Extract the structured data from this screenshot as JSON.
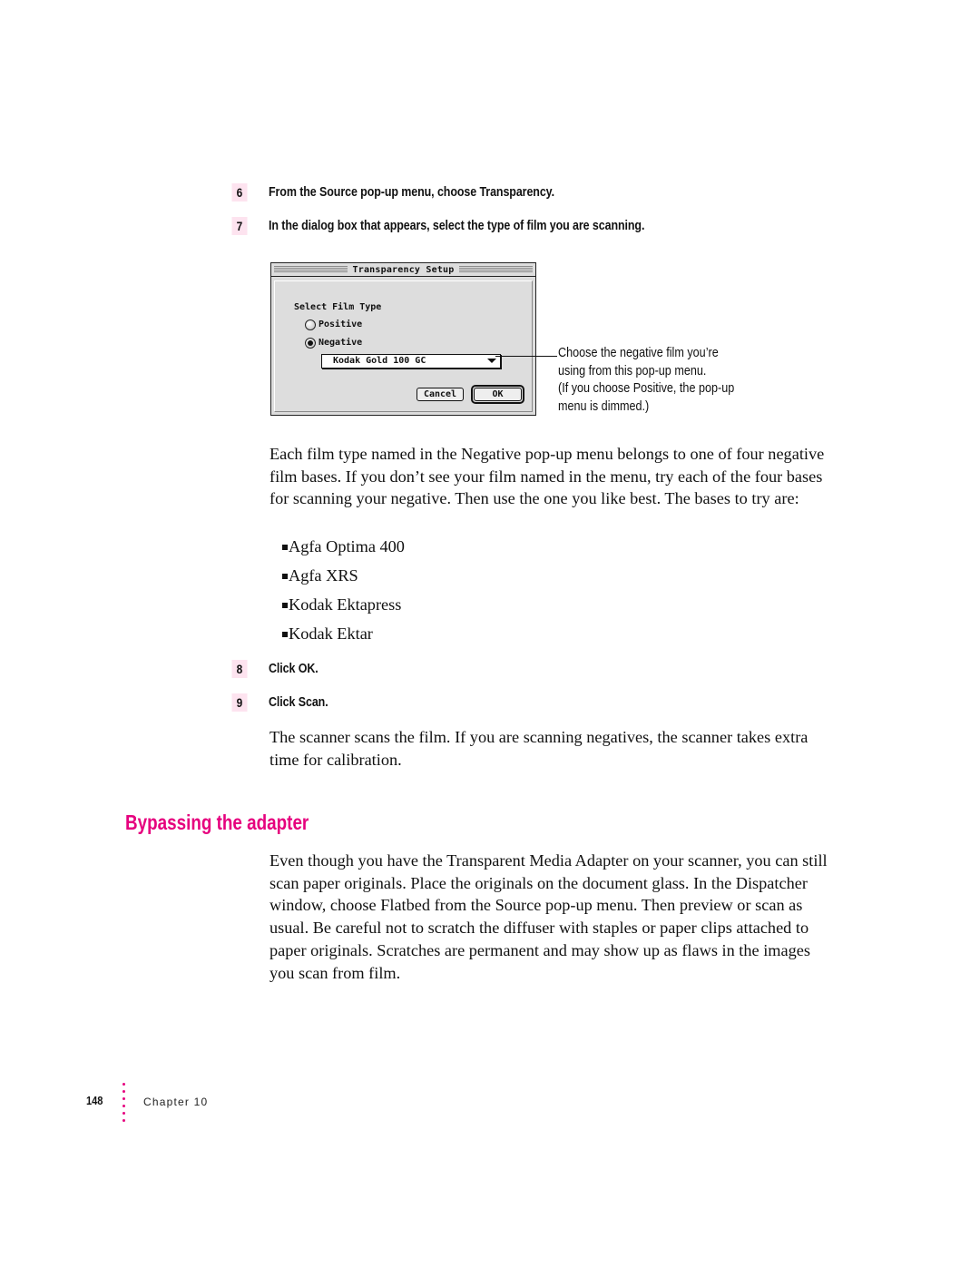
{
  "steps": [
    {
      "number": "6",
      "text": "From the Source pop-up menu, choose Transparency."
    },
    {
      "number": "7",
      "text": "In the dialog box that appears, select the type of film you are scanning."
    },
    {
      "number": "8",
      "text": "Click OK."
    },
    {
      "number": "9",
      "text": "Click Scan."
    }
  ],
  "dialog": {
    "title": "Transparency Setup",
    "group_label": "Select Film Type",
    "options": [
      {
        "label": "Positive",
        "selected": false
      },
      {
        "label": "Negative",
        "selected": true
      }
    ],
    "popup_value": "Kodak Gold 100 GC",
    "cancel_label": "Cancel",
    "ok_label": "OK"
  },
  "callout": [
    "Choose the negative film you’re",
    "using from this pop-up menu.",
    "(If you choose Positive, the pop-up",
    "menu is dimmed.)"
  ],
  "paragraph1": "Each film type named in the Negative pop-up menu belongs to one of four negative film bases. If you don’t see your film named in the menu, try each of the four bases for scanning your negative. Then use the one you like best. The bases to try are:",
  "film_bases": [
    "Agfa Optima 400",
    "Agfa XRS",
    "Kodak Ektapress",
    "Kodak Ektar"
  ],
  "paragraph2": "The scanner scans the film. If you are scanning negatives, the scanner takes extra time for calibration.",
  "section": {
    "heading": "Bypassing the adapter",
    "body": "Even though you have the Transparent Media Adapter on your scanner, you can still scan paper originals. Place the originals on the document glass. In the Dispatcher window, choose Flatbed from the Source pop-up menu. Then preview or scan as usual. Be careful not to scratch the diffuser with staples or paper clips attached to paper originals. Scratches are permanent and may show up as flaws in the images you scan from film."
  },
  "footer": {
    "page_number": "148",
    "chapter": "Chapter 10"
  },
  "colors": {
    "accent": "#e6007e",
    "step_badge_bg": "#fde3ef",
    "dialog_bg": "#dddddd"
  }
}
